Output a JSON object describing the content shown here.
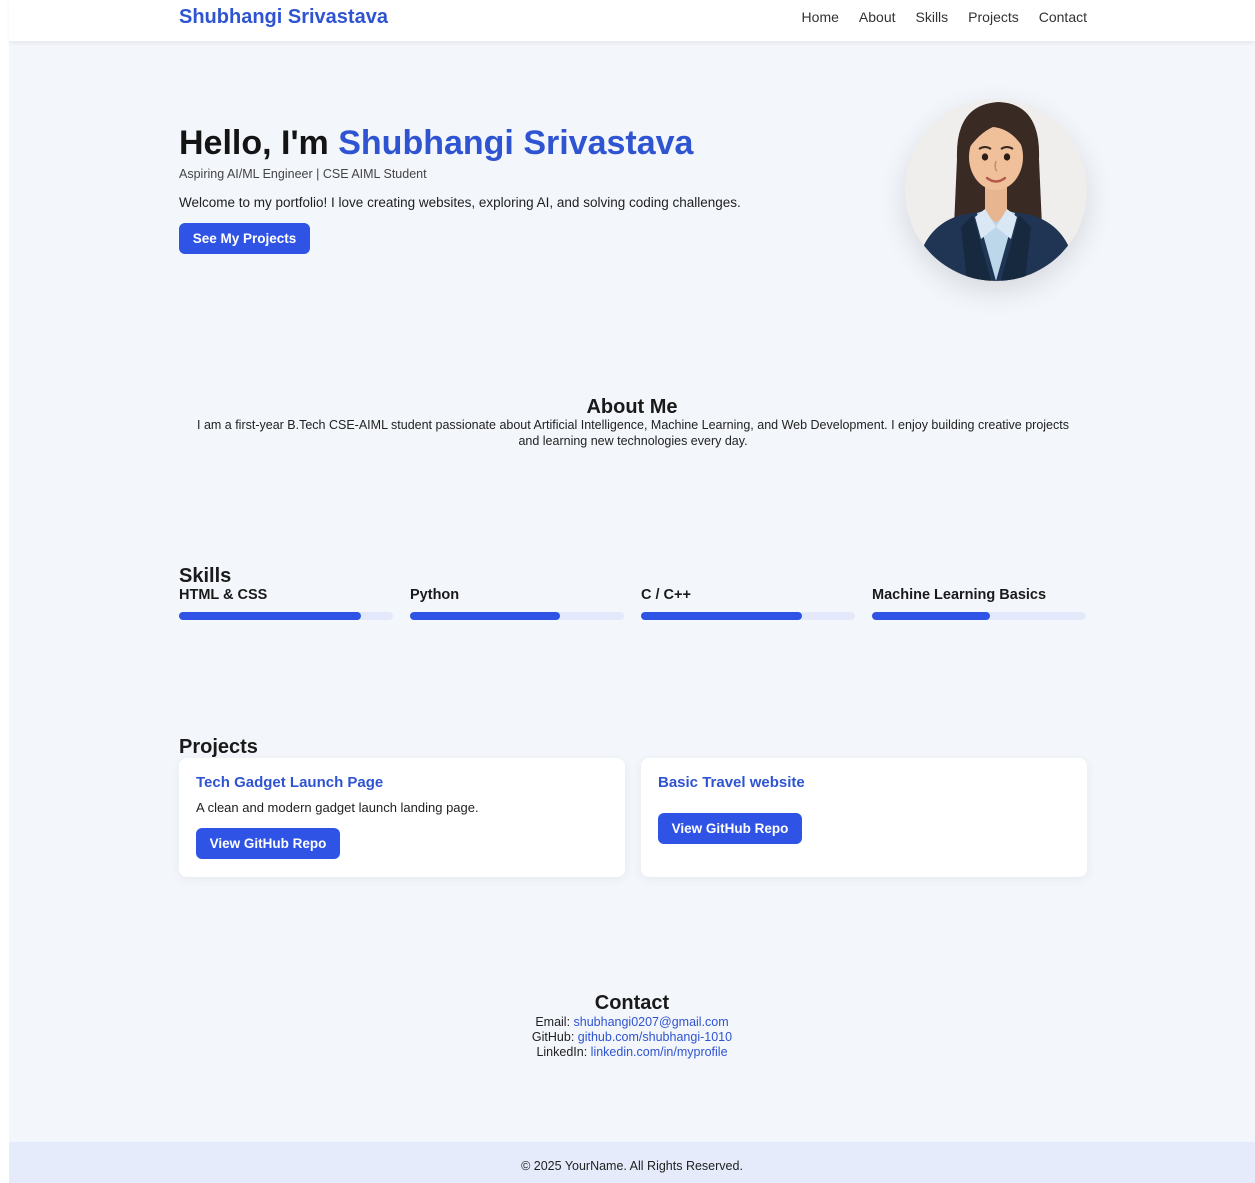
{
  "nav": {
    "brand": "Shubhangi Srivastava",
    "links": [
      "Home",
      "About",
      "Skills",
      "Projects",
      "Contact"
    ]
  },
  "hero": {
    "greeting": "Hello, I'm ",
    "name": "Shubhangi Srivastava",
    "subtitle": "Aspiring AI/ML Engineer | CSE AIML Student",
    "welcome": "Welcome to my portfolio! I love creating websites, exploring AI, and solving coding challenges.",
    "button_label": "See My Projects"
  },
  "about": {
    "title": "About Me",
    "text": "I am a first-year B.Tech CSE-AIML student passionate about Artificial Intelligence, Machine Learning, and Web Development. I enjoy building creative projects and learning new technologies every day."
  },
  "skills": {
    "title": "Skills",
    "items": [
      {
        "name": "HTML & CSS",
        "level": 0.85
      },
      {
        "name": "Python",
        "level": 0.7
      },
      {
        "name": "C / C++",
        "level": 0.75
      },
      {
        "name": "Machine Learning Basics",
        "level": 0.55
      }
    ]
  },
  "projects": {
    "title": "Projects",
    "items": [
      {
        "title": "Tech Gadget Launch Page",
        "description": "A clean and modern gadget launch landing page.",
        "button_label": "View GitHub Repo"
      },
      {
        "title": "Basic Travel website",
        "description": "",
        "button_label": "View GitHub Repo"
      }
    ]
  },
  "contact": {
    "title": "Contact",
    "email_label": "Email: ",
    "email": "shubhangi0207@gmail.com",
    "github_label": "GitHub: ",
    "github": "github.com/shubhangi-1010",
    "linkedin_label": "LinkedIn: ",
    "linkedin": "linkedin.com/in/myprofile"
  },
  "footer": {
    "text": "© 2025 YourName. All Rights Reserved."
  },
  "colors": {
    "accent": "#2f54d1",
    "button": "#2f54e5",
    "page_bg": "#f3f6fb",
    "footer_bg": "#e5ebfb"
  }
}
